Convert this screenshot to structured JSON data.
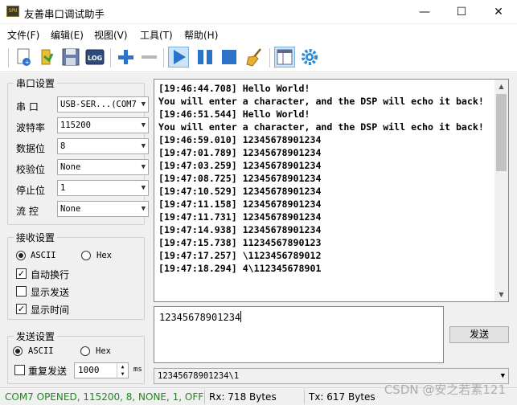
{
  "window": {
    "icon_text": "SPU",
    "title": "友善串口调试助手",
    "minimize": "—",
    "maximize": "☐",
    "close": "✕"
  },
  "menu": [
    "文件(F)",
    "编辑(E)",
    "视图(V)",
    "工具(T)",
    "帮助(H)"
  ],
  "toolbar": {
    "icons": [
      "new-connection-icon",
      "open-icon",
      "save-icon",
      "log-icon",
      "add-icon",
      "remove-icon",
      "play-icon",
      "pause-icon",
      "stop-icon",
      "clear-broom-icon",
      "layout-icon",
      "settings-gear-icon"
    ],
    "log_text": "LOG",
    "accent": "#2b73c8"
  },
  "serial_settings": {
    "title": "串口设置",
    "fields": [
      {
        "label": "串  口",
        "value": "USB-SER...(COM7"
      },
      {
        "label": "波特率",
        "value": "115200"
      },
      {
        "label": "数据位",
        "value": "8"
      },
      {
        "label": "校验位",
        "value": "None"
      },
      {
        "label": "停止位",
        "value": "1"
      },
      {
        "label": "流  控",
        "value": "None"
      }
    ]
  },
  "receive_settings": {
    "title": "接收设置",
    "ascii": "ASCII",
    "hex": "Hex",
    "auto_wrap": "自动换行",
    "show_send": "显示发送",
    "show_time": "显示时间"
  },
  "send_settings": {
    "title": "发送设置",
    "ascii": "ASCII",
    "hex": "Hex",
    "repeat": "重复发送",
    "interval": "1000",
    "unit": "ms"
  },
  "receive_area": {
    "text": "[19:46:44.708] Hello World!\nYou will enter a character, and the DSP will echo it back!\n[19:46:51.544] Hello World!\nYou will enter a character, and the DSP will echo it back!\n[19:46:59.010] 12345678901234\n[19:47:01.789] 12345678901234\n[19:47:03.259] 12345678901234\n[19:47:08.725] 12345678901234\n[19:47:10.529] 12345678901234\n[19:47:11.158] 12345678901234\n[19:47:11.731] 12345678901234\n[19:47:14.938] 12345678901234\n[19:47:15.738] 11234567890123\n[19:47:17.257] \\1123456789012\n[19:47:18.294] 4\\112345678901"
  },
  "send_area": {
    "text": "12345678901234",
    "send_button": "发送",
    "history": "12345678901234\\1"
  },
  "status": {
    "port": "COM7 OPENED, 115200, 8, NONE, 1, OFF",
    "port_color": "#1a8a1a",
    "rx": "Rx: 718 Bytes",
    "tx": "Tx: 617 Bytes"
  },
  "watermark": "CSDN @安之若素121"
}
